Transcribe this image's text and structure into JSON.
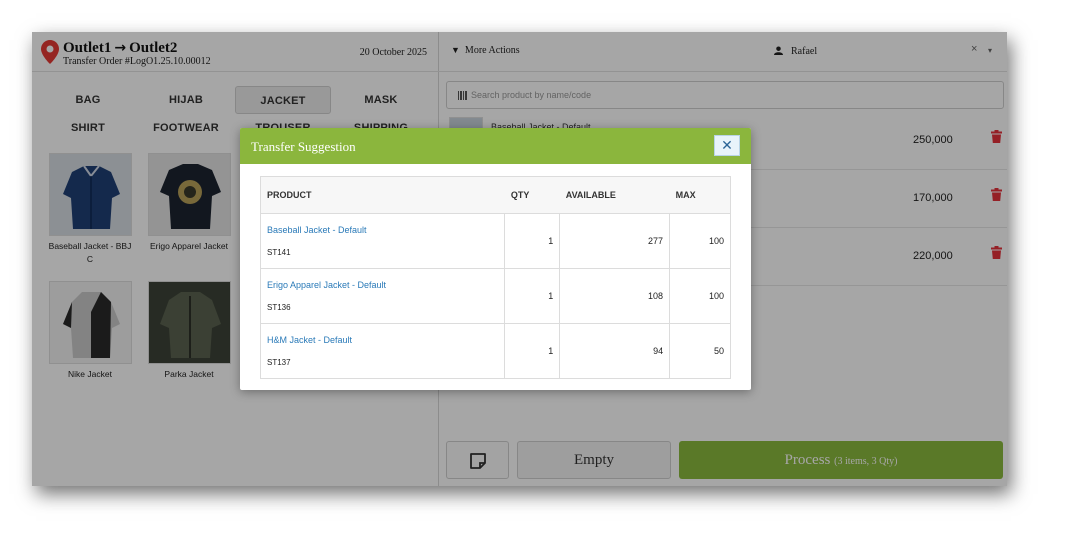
{
  "header": {
    "from": "Outlet1",
    "arrow": "→",
    "to": "Outlet2",
    "order": "Transfer Order #LogO1.25.10.00012",
    "date": "20 October 2025"
  },
  "categories": [
    "BAG",
    "HIJAB",
    "JACKET",
    "MASK",
    "SHIRT",
    "FOOTWEAR",
    "TROUSER",
    "SHIPPING"
  ],
  "active_category": "JACKET",
  "products": [
    {
      "name": "Baseball Jacket - BBJ C"
    },
    {
      "name": "Erigo Apparel Jacket"
    },
    {
      "name": "Nike Jacket"
    },
    {
      "name": "Parka Jacket"
    }
  ],
  "topbar": {
    "more_actions": "More Actions",
    "user": "Rafael",
    "clear": "×",
    "dropdown": "▾"
  },
  "search": {
    "placeholder": "Search product by name/code"
  },
  "cart": [
    {
      "name": "Baseball Jacket - Default",
      "price": "250,000"
    },
    {
      "name": "",
      "price": "170,000"
    },
    {
      "name": "",
      "price": "220,000"
    }
  ],
  "buttons": {
    "empty": "Empty",
    "process": "Process",
    "process_sub": "(3 items, 3 Qty)"
  },
  "modal": {
    "title": "Transfer Suggestion",
    "close": "✕",
    "columns": [
      "PRODUCT",
      "QTY",
      "AVAILABLE",
      "MAX"
    ],
    "rows": [
      {
        "product": "Baseball Jacket - Default",
        "sku": "ST141",
        "qty": "1",
        "available": "277",
        "max": "100"
      },
      {
        "product": "Erigo Apparel Jacket - Default",
        "sku": "ST136",
        "qty": "1",
        "available": "108",
        "max": "100"
      },
      {
        "product": "H&M Jacket - Default",
        "sku": "ST137",
        "qty": "1",
        "available": "94",
        "max": "50"
      }
    ]
  },
  "colors": {
    "accent_green": "#8bb63d",
    "link_blue": "#2a7ab8",
    "trash_red": "#e5323b",
    "pin_red": "#e53935"
  }
}
